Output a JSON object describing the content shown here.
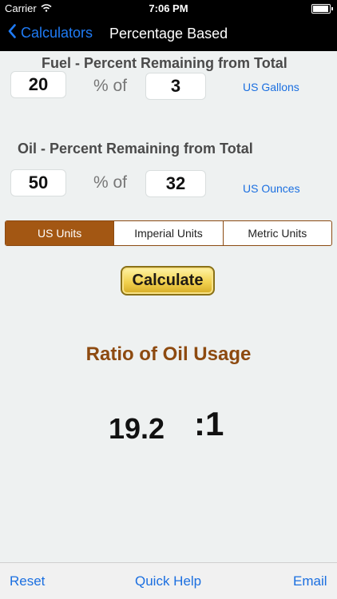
{
  "status_bar": {
    "carrier": "Carrier",
    "time": "7:06 PM"
  },
  "nav": {
    "back_label": "Calculators",
    "title": "Percentage Based"
  },
  "fuel": {
    "title": "Fuel - Percent Remaining from Total",
    "percent_value": "20",
    "of_label": "% of",
    "amount_value": "3",
    "unit": "US Gallons"
  },
  "oil": {
    "title": "Oil - Percent Remaining from Total",
    "percent_value": "50",
    "of_label": "% of",
    "amount_value": "32",
    "unit": "US Ounces"
  },
  "units": {
    "options": [
      "US Units",
      "Imperial Units",
      "Metric Units"
    ],
    "selected": "US Units"
  },
  "actions": {
    "calculate_label": "Calculate"
  },
  "result": {
    "title": "Ratio of Oil Usage",
    "value": "19.2",
    "suffix": ":1"
  },
  "toolbar": {
    "reset": "Reset",
    "quick_help": "Quick Help",
    "email": "Email"
  },
  "colors": {
    "accent_blue": "#1b6fe0",
    "selected_segment": "#a35713",
    "result_title": "#8d4a10"
  }
}
